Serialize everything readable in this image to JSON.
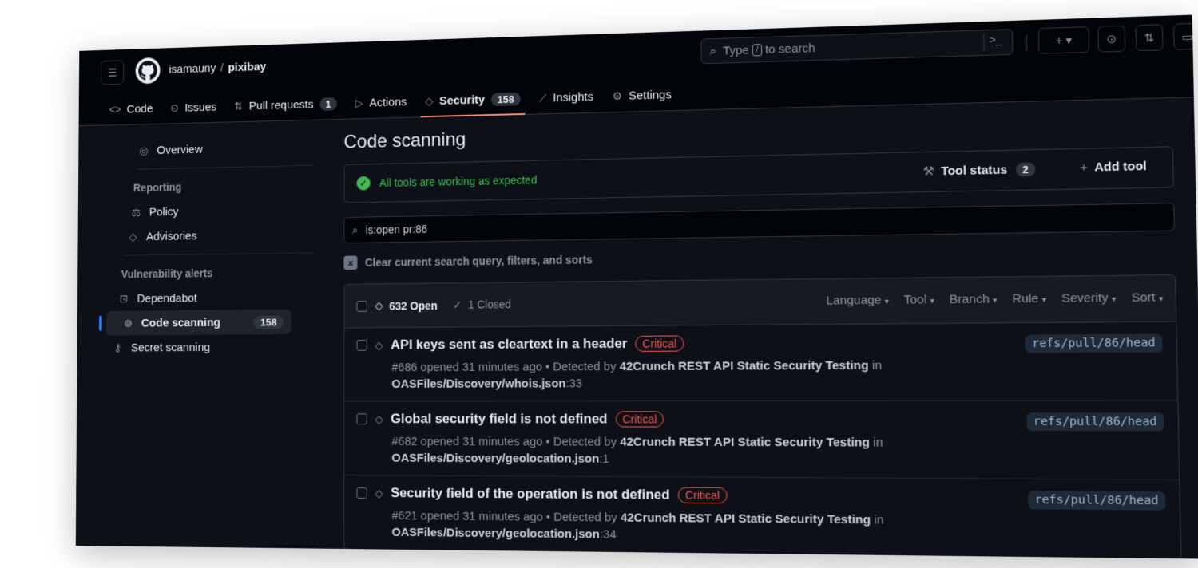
{
  "header": {
    "owner": "isamauny",
    "separator": "/",
    "repo": "pixibay",
    "search_prefix": "Type",
    "search_key": "/",
    "search_suffix": "to search",
    "plus_label": "+ ▾"
  },
  "nav": [
    {
      "label": "Code",
      "icon": "code-icon",
      "glyph": "<>"
    },
    {
      "label": "Issues",
      "icon": "issue-icon",
      "glyph": "⊙"
    },
    {
      "label": "Pull requests",
      "icon": "pull-request-icon",
      "glyph": "⇅",
      "count": "1"
    },
    {
      "label": "Actions",
      "icon": "play-icon",
      "glyph": "▷"
    },
    {
      "label": "Security",
      "icon": "shield-icon",
      "glyph": "◇",
      "count": "158",
      "active": true
    },
    {
      "label": "Insights",
      "icon": "graph-icon",
      "glyph": "⟋"
    },
    {
      "label": "Settings",
      "icon": "gear-icon",
      "glyph": "⚙"
    }
  ],
  "sidebar": {
    "overview": "Overview",
    "reporting_heading": "Reporting",
    "policy": "Policy",
    "advisories": "Advisories",
    "vuln_heading": "Vulnerability alerts",
    "dependabot": "Dependabot",
    "code_scanning": "Code scanning",
    "code_scanning_count": "158",
    "secret_scanning": "Secret scanning"
  },
  "main": {
    "title": "Code scanning",
    "tools_ok": "All tools are working as expected",
    "tool_status": "Tool status",
    "tool_status_count": "2",
    "add_tool": "Add tool",
    "query": "is:open pr:86",
    "clear_label": "Clear current search query, filters, and sorts"
  },
  "alerts_header": {
    "open": "632 Open",
    "closed": "1 Closed",
    "filters": [
      "Language",
      "Tool",
      "Branch",
      "Rule",
      "Severity",
      "Sort"
    ]
  },
  "alerts": [
    {
      "title": "API keys sent as cleartext in a header",
      "severity": "Critical",
      "meta_prefix": "#686 opened 31 minutes ago • Detected by",
      "tool": "42Crunch REST API Static Security Testing",
      "meta_in": "in",
      "file": "OASFiles/Discovery/whois.json",
      "line": ":33",
      "ref": "refs/pull/86/head"
    },
    {
      "title": "Global security field is not defined",
      "severity": "Critical",
      "meta_prefix": "#682 opened 31 minutes ago • Detected by",
      "tool": "42Crunch REST API Static Security Testing",
      "meta_in": "in",
      "file": "OASFiles/Discovery/geolocation.json",
      "line": ":1",
      "ref": "refs/pull/86/head"
    },
    {
      "title": "Security field of the operation is not defined",
      "severity": "Critical",
      "meta_prefix": "#621 opened 31 minutes ago • Detected by",
      "tool": "42Crunch REST API Static Security Testing",
      "meta_in": "in",
      "file": "OASFiles/Discovery/geolocation.json",
      "line": ":34",
      "ref": "refs/pull/86/head"
    }
  ]
}
